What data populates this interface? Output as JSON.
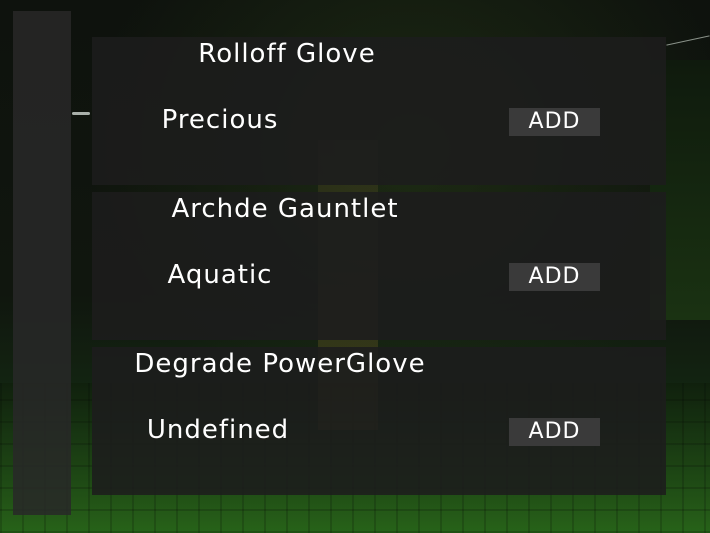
{
  "gloves": [
    {
      "name": "Rolloff Glove",
      "rarity": "Precious",
      "button_label": "ADD"
    },
    {
      "name": "Archde Gauntlet",
      "rarity": "Aquatic",
      "button_label": "ADD"
    },
    {
      "name": "Degrade PowerGlove",
      "rarity": "Undefined",
      "button_label": "ADD"
    }
  ],
  "colors": {
    "panel": "#1c1c1c",
    "button": "#3a3a3a",
    "text": "#ffffff"
  }
}
